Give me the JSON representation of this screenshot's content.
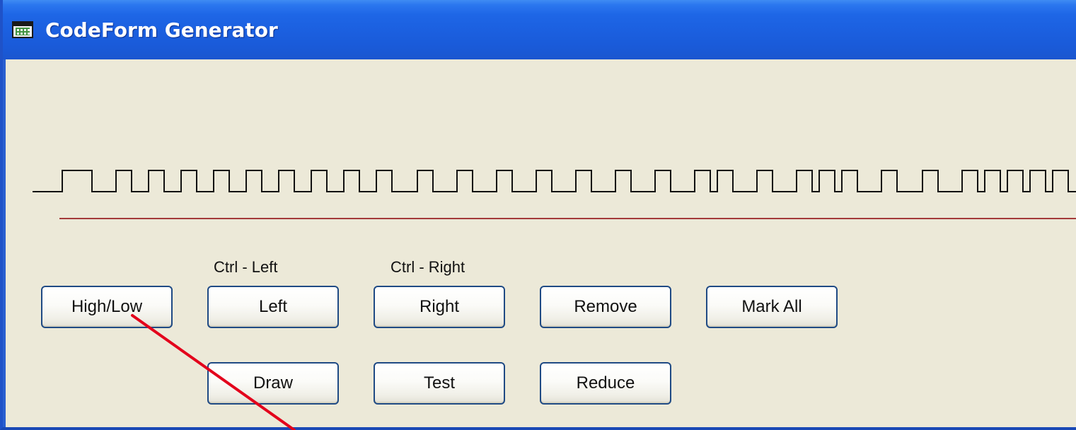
{
  "window": {
    "title": "CodeForm Generator",
    "icon": "grid-window-icon"
  },
  "labels": {
    "ctrl_left": "Ctrl - Left",
    "ctrl_right": "Ctrl - Right"
  },
  "buttons": {
    "high_low": "High/Low",
    "left": "Left",
    "right": "Right",
    "remove": "Remove",
    "mark_all": "Mark All",
    "draw": "Draw",
    "test": "Test",
    "reduce": "Reduce"
  },
  "colors": {
    "titlebar": "#1b5fdf",
    "client_background": "#ece9d8",
    "waveform": "#111111",
    "baseline": "#a33a3a",
    "annotation_arrow": "#e3001b"
  }
}
